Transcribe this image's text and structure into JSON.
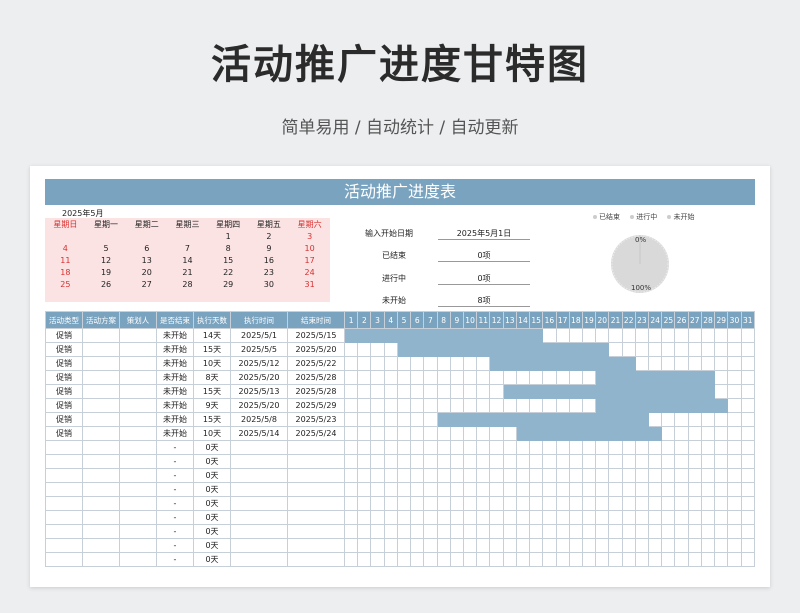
{
  "header": {
    "title": "活动推广进度甘特图",
    "subtitle": "简单易用 / 自动统计 / 自动更新"
  },
  "sheet": {
    "banner": "活动推广进度表",
    "calendar": {
      "year_month": "2025年5月",
      "weekdays": [
        "星期日",
        "星期一",
        "星期二",
        "星期三",
        "星期四",
        "星期五",
        "星期六"
      ],
      "weeks": [
        [
          "",
          "",
          "",
          "",
          "1",
          "2",
          "3"
        ],
        [
          "4",
          "5",
          "6",
          "7",
          "8",
          "9",
          "10"
        ],
        [
          "11",
          "12",
          "13",
          "14",
          "15",
          "16",
          "17"
        ],
        [
          "18",
          "19",
          "20",
          "21",
          "22",
          "23",
          "24"
        ],
        [
          "25",
          "26",
          "27",
          "28",
          "29",
          "30",
          "31"
        ]
      ]
    },
    "info": {
      "start_label": "输入开始日期",
      "start_value": "2025年5月1日",
      "done_label": "已结束",
      "done_value": "0项",
      "progress_label": "进行中",
      "progress_value": "0项",
      "notstarted_label": "未开始",
      "notstarted_value": "8项"
    },
    "legend": [
      "已结束",
      "进行中",
      "未开始"
    ],
    "donut": {
      "top_label": "0%",
      "bottom_label": "100%",
      "color": "#d9d9d9"
    },
    "columns": [
      "活动类型",
      "活动方案",
      "策划人",
      "是否结束",
      "执行天数",
      "执行时间",
      "结束时间"
    ],
    "days": [
      "1",
      "2",
      "3",
      "4",
      "5",
      "6",
      "7",
      "8",
      "9",
      "10",
      "11",
      "12",
      "13",
      "14",
      "15",
      "16",
      "17",
      "18",
      "19",
      "20",
      "21",
      "22",
      "23",
      "24",
      "25",
      "26",
      "27",
      "28",
      "29",
      "30",
      "31"
    ],
    "bar_color": "#8fb4cc",
    "rows": [
      {
        "type": "促销",
        "plan": "",
        "owner": "",
        "status": "未开始",
        "days": "14天",
        "start": "2025/5/1",
        "end": "2025/5/15",
        "s": 1,
        "e": 15
      },
      {
        "type": "促销",
        "plan": "",
        "owner": "",
        "status": "未开始",
        "days": "15天",
        "start": "2025/5/5",
        "end": "2025/5/20",
        "s": 5,
        "e": 20
      },
      {
        "type": "促销",
        "plan": "",
        "owner": "",
        "status": "未开始",
        "days": "10天",
        "start": "2025/5/12",
        "end": "2025/5/22",
        "s": 12,
        "e": 22
      },
      {
        "type": "促销",
        "plan": "",
        "owner": "",
        "status": "未开始",
        "days": "8天",
        "start": "2025/5/20",
        "end": "2025/5/28",
        "s": 20,
        "e": 28
      },
      {
        "type": "促销",
        "plan": "",
        "owner": "",
        "status": "未开始",
        "days": "15天",
        "start": "2025/5/13",
        "end": "2025/5/28",
        "s": 13,
        "e": 28
      },
      {
        "type": "促销",
        "plan": "",
        "owner": "",
        "status": "未开始",
        "days": "9天",
        "start": "2025/5/20",
        "end": "2025/5/29",
        "s": 20,
        "e": 29
      },
      {
        "type": "促销",
        "plan": "",
        "owner": "",
        "status": "未开始",
        "days": "15天",
        "start": "2025/5/8",
        "end": "2025/5/23",
        "s": 8,
        "e": 23
      },
      {
        "type": "促销",
        "plan": "",
        "owner": "",
        "status": "未开始",
        "days": "10天",
        "start": "2025/5/14",
        "end": "2025/5/24",
        "s": 14,
        "e": 24
      },
      {
        "type": "",
        "plan": "",
        "owner": "",
        "status": "-",
        "days": "0天",
        "start": "",
        "end": "",
        "s": 0,
        "e": 0
      },
      {
        "type": "",
        "plan": "",
        "owner": "",
        "status": "-",
        "days": "0天",
        "start": "",
        "end": "",
        "s": 0,
        "e": 0
      },
      {
        "type": "",
        "plan": "",
        "owner": "",
        "status": "-",
        "days": "0天",
        "start": "",
        "end": "",
        "s": 0,
        "e": 0
      },
      {
        "type": "",
        "plan": "",
        "owner": "",
        "status": "-",
        "days": "0天",
        "start": "",
        "end": "",
        "s": 0,
        "e": 0
      },
      {
        "type": "",
        "plan": "",
        "owner": "",
        "status": "-",
        "days": "0天",
        "start": "",
        "end": "",
        "s": 0,
        "e": 0
      },
      {
        "type": "",
        "plan": "",
        "owner": "",
        "status": "-",
        "days": "0天",
        "start": "",
        "end": "",
        "s": 0,
        "e": 0
      },
      {
        "type": "",
        "plan": "",
        "owner": "",
        "status": "-",
        "days": "0天",
        "start": "",
        "end": "",
        "s": 0,
        "e": 0
      },
      {
        "type": "",
        "plan": "",
        "owner": "",
        "status": "-",
        "days": "0天",
        "start": "",
        "end": "",
        "s": 0,
        "e": 0
      },
      {
        "type": "",
        "plan": "",
        "owner": "",
        "status": "-",
        "days": "0天",
        "start": "",
        "end": "",
        "s": 0,
        "e": 0
      }
    ]
  }
}
